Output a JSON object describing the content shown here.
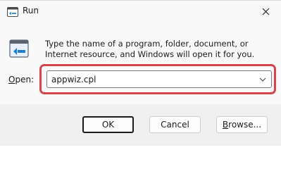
{
  "window": {
    "title": "Run",
    "title_icon": "run-dialog-icon",
    "close_icon": "close-icon"
  },
  "content": {
    "icon": "run-app-icon",
    "description": "Type the name of a program, folder, document, or Internet resource, and Windows will open it for you.",
    "open_label_accel": "O",
    "open_label_rest": "pen:",
    "input_value": "appwiz.cpl",
    "dropdown_icon": "chevron-down-icon",
    "highlight_color": "#d3474b"
  },
  "buttons": {
    "ok": "OK",
    "cancel": "Cancel",
    "browse_accel": "B",
    "browse_rest": "rowse..."
  }
}
